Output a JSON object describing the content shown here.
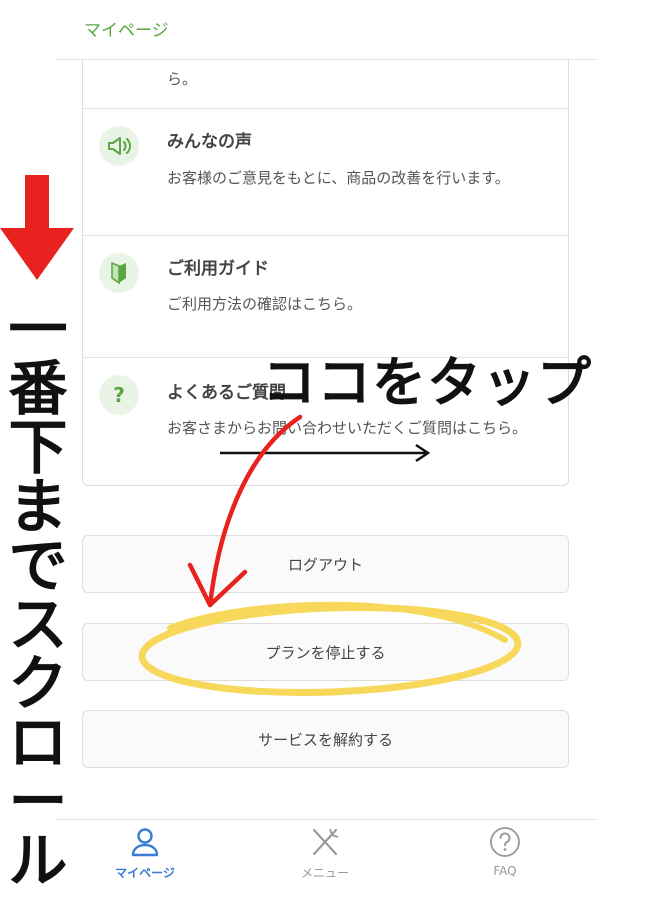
{
  "header": {
    "title": "マイページ"
  },
  "list": {
    "partial_text": "ら。",
    "items": [
      {
        "title": "みんなの声",
        "desc": "お客様のご意見をもとに、商品の改善を行います。"
      },
      {
        "title": "ご利用ガイド",
        "desc": "ご利用方法の確認はこちら。"
      },
      {
        "title": "よくあるご質問",
        "desc": "お客さまからお問い合わせいただくご質問はこちら。",
        "icon_glyph": "?"
      }
    ]
  },
  "buttons": {
    "logout": "ログアウト",
    "stop_plan": "プランを停止する",
    "cancel_service": "サービスを解約する"
  },
  "bottom_nav": [
    {
      "label": "マイページ",
      "icon": "person-icon",
      "active": true
    },
    {
      "label": "メニュー",
      "icon": "fork-knife-icon",
      "active": false
    },
    {
      "label": "FAQ",
      "icon": "question-circle-icon",
      "active": false
    }
  ],
  "annotations": {
    "side_text": [
      "一",
      "番",
      "下",
      "ま",
      "で",
      "ス",
      "ク",
      "ロ",
      "ー",
      "ル"
    ],
    "tap_text": "ココをタップ"
  },
  "colors": {
    "accent_green": "#5aa642",
    "nav_active": "#3a7bd5",
    "arrow_red": "#e8231f",
    "highlight_yellow": "#f7d85a"
  }
}
